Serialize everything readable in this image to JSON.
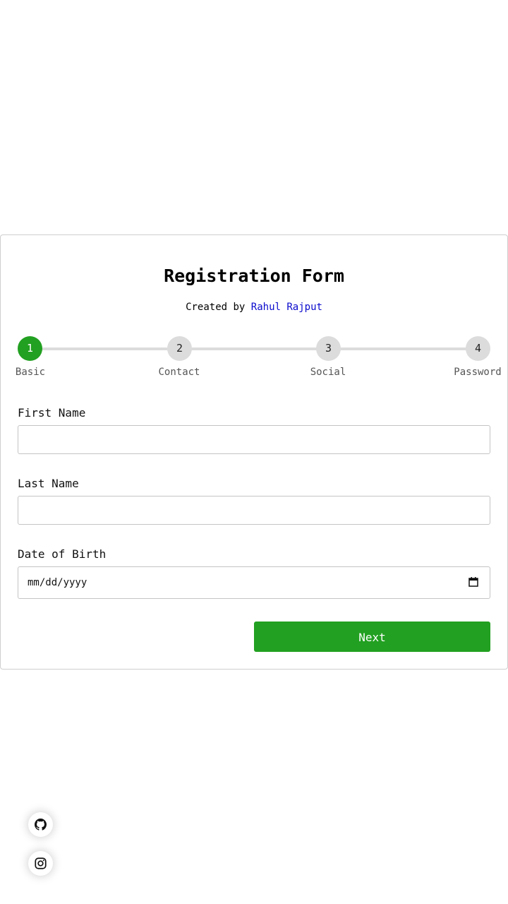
{
  "form": {
    "title": "Registration Form",
    "credit_prefix": "Created by ",
    "credit_name": "Rahul Rajput"
  },
  "steps": [
    {
      "number": "1",
      "label": "Basic",
      "active": true
    },
    {
      "number": "2",
      "label": "Contact",
      "active": false
    },
    {
      "number": "3",
      "label": "Social",
      "active": false
    },
    {
      "number": "4",
      "label": "Password",
      "active": false
    }
  ],
  "fields": {
    "first_name": {
      "label": "First Name",
      "value": ""
    },
    "last_name": {
      "label": "Last Name",
      "value": ""
    },
    "dob": {
      "label": "Date of Birth",
      "placeholder": "mm/dd/yyyy"
    }
  },
  "buttons": {
    "next_label": "Next"
  },
  "social_links": [
    {
      "icon": "github-icon"
    },
    {
      "icon": "instagram-icon"
    }
  ],
  "colors": {
    "accent": "#22a021",
    "link": "#0a0acd",
    "inactive_step": "#dcdcdc"
  }
}
